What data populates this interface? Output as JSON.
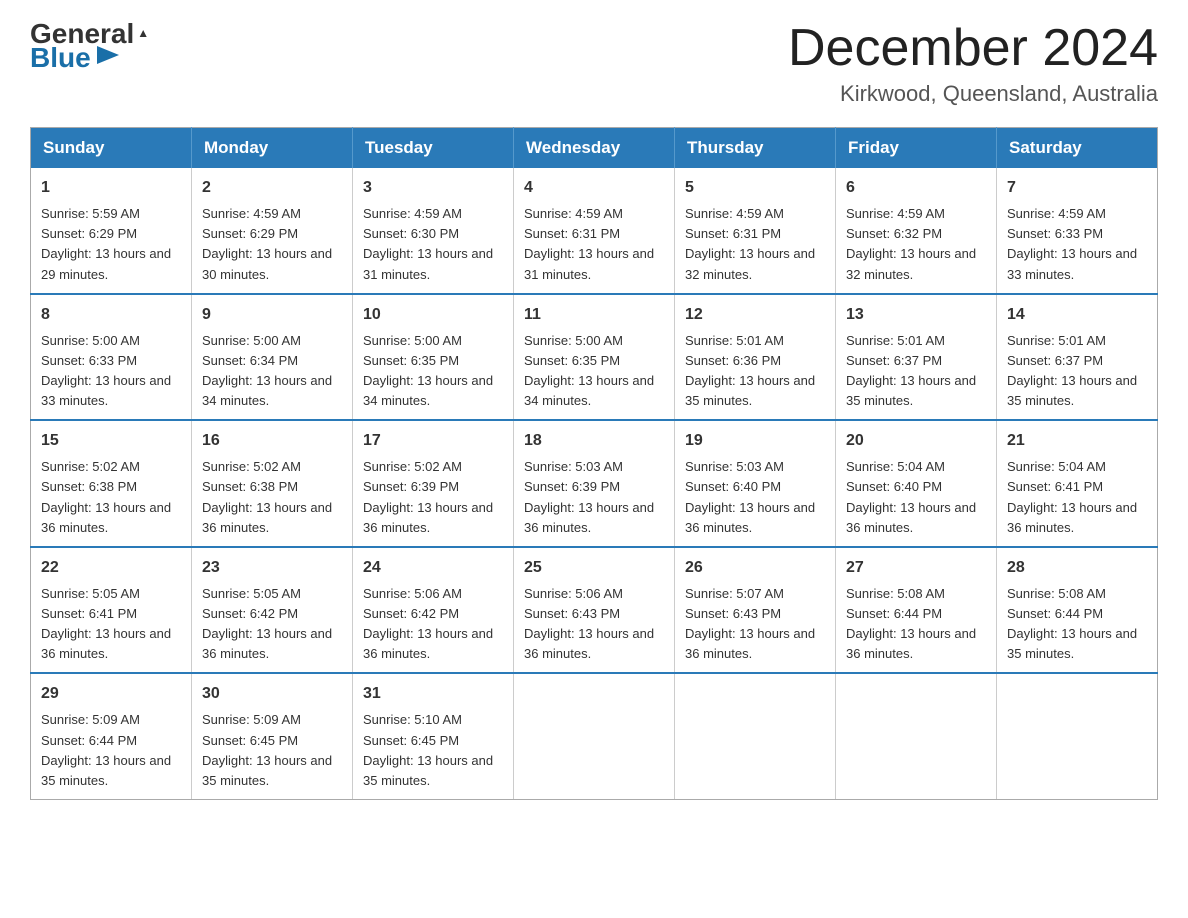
{
  "logo": {
    "general": "General",
    "blue": "Blue",
    "arrow": "▶"
  },
  "title": "December 2024",
  "subtitle": "Kirkwood, Queensland, Australia",
  "days_of_week": [
    "Sunday",
    "Monday",
    "Tuesday",
    "Wednesday",
    "Thursday",
    "Friday",
    "Saturday"
  ],
  "weeks": [
    [
      {
        "day": "1",
        "sunrise": "5:59 AM",
        "sunset": "6:29 PM",
        "daylight": "13 hours and 29 minutes."
      },
      {
        "day": "2",
        "sunrise": "4:59 AM",
        "sunset": "6:29 PM",
        "daylight": "13 hours and 30 minutes."
      },
      {
        "day": "3",
        "sunrise": "4:59 AM",
        "sunset": "6:30 PM",
        "daylight": "13 hours and 31 minutes."
      },
      {
        "day": "4",
        "sunrise": "4:59 AM",
        "sunset": "6:31 PM",
        "daylight": "13 hours and 31 minutes."
      },
      {
        "day": "5",
        "sunrise": "4:59 AM",
        "sunset": "6:31 PM",
        "daylight": "13 hours and 32 minutes."
      },
      {
        "day": "6",
        "sunrise": "4:59 AM",
        "sunset": "6:32 PM",
        "daylight": "13 hours and 32 minutes."
      },
      {
        "day": "7",
        "sunrise": "4:59 AM",
        "sunset": "6:33 PM",
        "daylight": "13 hours and 33 minutes."
      }
    ],
    [
      {
        "day": "8",
        "sunrise": "5:00 AM",
        "sunset": "6:33 PM",
        "daylight": "13 hours and 33 minutes."
      },
      {
        "day": "9",
        "sunrise": "5:00 AM",
        "sunset": "6:34 PM",
        "daylight": "13 hours and 34 minutes."
      },
      {
        "day": "10",
        "sunrise": "5:00 AM",
        "sunset": "6:35 PM",
        "daylight": "13 hours and 34 minutes."
      },
      {
        "day": "11",
        "sunrise": "5:00 AM",
        "sunset": "6:35 PM",
        "daylight": "13 hours and 34 minutes."
      },
      {
        "day": "12",
        "sunrise": "5:01 AM",
        "sunset": "6:36 PM",
        "daylight": "13 hours and 35 minutes."
      },
      {
        "day": "13",
        "sunrise": "5:01 AM",
        "sunset": "6:37 PM",
        "daylight": "13 hours and 35 minutes."
      },
      {
        "day": "14",
        "sunrise": "5:01 AM",
        "sunset": "6:37 PM",
        "daylight": "13 hours and 35 minutes."
      }
    ],
    [
      {
        "day": "15",
        "sunrise": "5:02 AM",
        "sunset": "6:38 PM",
        "daylight": "13 hours and 36 minutes."
      },
      {
        "day": "16",
        "sunrise": "5:02 AM",
        "sunset": "6:38 PM",
        "daylight": "13 hours and 36 minutes."
      },
      {
        "day": "17",
        "sunrise": "5:02 AM",
        "sunset": "6:39 PM",
        "daylight": "13 hours and 36 minutes."
      },
      {
        "day": "18",
        "sunrise": "5:03 AM",
        "sunset": "6:39 PM",
        "daylight": "13 hours and 36 minutes."
      },
      {
        "day": "19",
        "sunrise": "5:03 AM",
        "sunset": "6:40 PM",
        "daylight": "13 hours and 36 minutes."
      },
      {
        "day": "20",
        "sunrise": "5:04 AM",
        "sunset": "6:40 PM",
        "daylight": "13 hours and 36 minutes."
      },
      {
        "day": "21",
        "sunrise": "5:04 AM",
        "sunset": "6:41 PM",
        "daylight": "13 hours and 36 minutes."
      }
    ],
    [
      {
        "day": "22",
        "sunrise": "5:05 AM",
        "sunset": "6:41 PM",
        "daylight": "13 hours and 36 minutes."
      },
      {
        "day": "23",
        "sunrise": "5:05 AM",
        "sunset": "6:42 PM",
        "daylight": "13 hours and 36 minutes."
      },
      {
        "day": "24",
        "sunrise": "5:06 AM",
        "sunset": "6:42 PM",
        "daylight": "13 hours and 36 minutes."
      },
      {
        "day": "25",
        "sunrise": "5:06 AM",
        "sunset": "6:43 PM",
        "daylight": "13 hours and 36 minutes."
      },
      {
        "day": "26",
        "sunrise": "5:07 AM",
        "sunset": "6:43 PM",
        "daylight": "13 hours and 36 minutes."
      },
      {
        "day": "27",
        "sunrise": "5:08 AM",
        "sunset": "6:44 PM",
        "daylight": "13 hours and 36 minutes."
      },
      {
        "day": "28",
        "sunrise": "5:08 AM",
        "sunset": "6:44 PM",
        "daylight": "13 hours and 35 minutes."
      }
    ],
    [
      {
        "day": "29",
        "sunrise": "5:09 AM",
        "sunset": "6:44 PM",
        "daylight": "13 hours and 35 minutes."
      },
      {
        "day": "30",
        "sunrise": "5:09 AM",
        "sunset": "6:45 PM",
        "daylight": "13 hours and 35 minutes."
      },
      {
        "day": "31",
        "sunrise": "5:10 AM",
        "sunset": "6:45 PM",
        "daylight": "13 hours and 35 minutes."
      },
      null,
      null,
      null,
      null
    ]
  ]
}
